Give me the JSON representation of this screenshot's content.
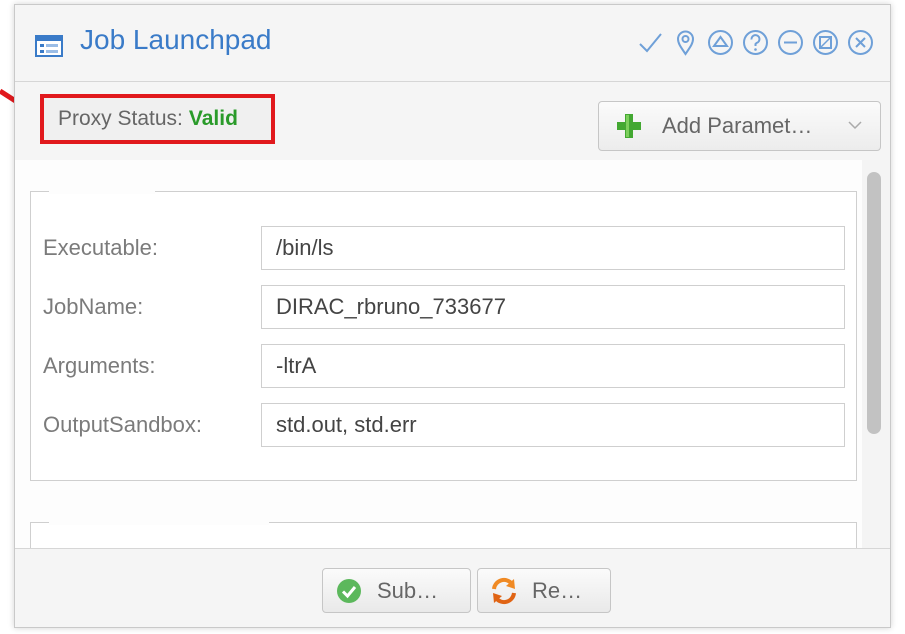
{
  "window": {
    "title": "Job Launchpad",
    "tools": [
      "check-icon",
      "pin-icon",
      "collapse-icon",
      "help-icon",
      "minimize-icon",
      "restore-icon",
      "close-icon"
    ]
  },
  "toolbar": {
    "proxy_label": "Proxy Status:",
    "proxy_value": "Valid",
    "add_parameter_label": "Add Paramet…"
  },
  "form": {
    "fields": [
      {
        "label": "Executable:",
        "value": "/bin/ls"
      },
      {
        "label": "JobName:",
        "value": "DIRAC_rbruno_733677"
      },
      {
        "label": "Arguments:",
        "value": "-ltrA"
      },
      {
        "label": "OutputSandbox:",
        "value": "std.out, std.err"
      }
    ]
  },
  "footer": {
    "submit_label": "Sub…",
    "reset_label": "Re…"
  },
  "colors": {
    "accent": "#3a7bc8",
    "valid": "#2a9b2a",
    "highlight": "#e1191d"
  }
}
